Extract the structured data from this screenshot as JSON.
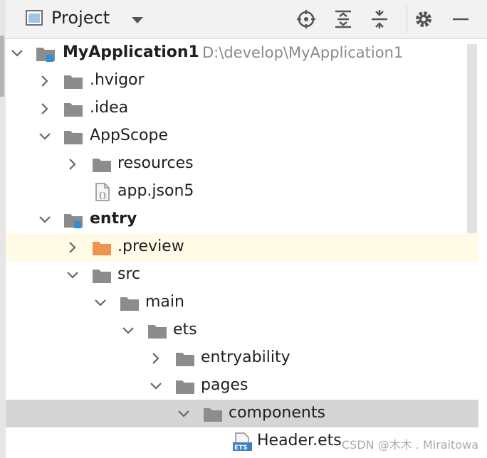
{
  "panel": {
    "title": "Project",
    "toolbar": [
      "locate-icon",
      "expand-all-icon",
      "collapse-all-icon",
      "gear-icon",
      "minimize-icon"
    ]
  },
  "tree": {
    "root": {
      "label": "MyApplication1",
      "path": "D:\\develop\\MyApplication1"
    },
    "hvigor": ".hvigor",
    "idea": ".idea",
    "appscope": "AppScope",
    "resources": "resources",
    "appjson": "app.json5",
    "entry": "entry",
    "preview": ".preview",
    "src": "src",
    "main": "main",
    "ets": "ets",
    "entryability": "entryability",
    "pages": "pages",
    "components": "components",
    "header": "Header.ets"
  },
  "watermark": "CSDN @木木 . Miraitowa",
  "colors": {
    "folder": "#8c8c8c",
    "excluded_folder": "#f0914e",
    "module_badge": "#2f8fd8",
    "selected_row": "#d5d5d5",
    "highlight_row": "#fffbe6"
  }
}
